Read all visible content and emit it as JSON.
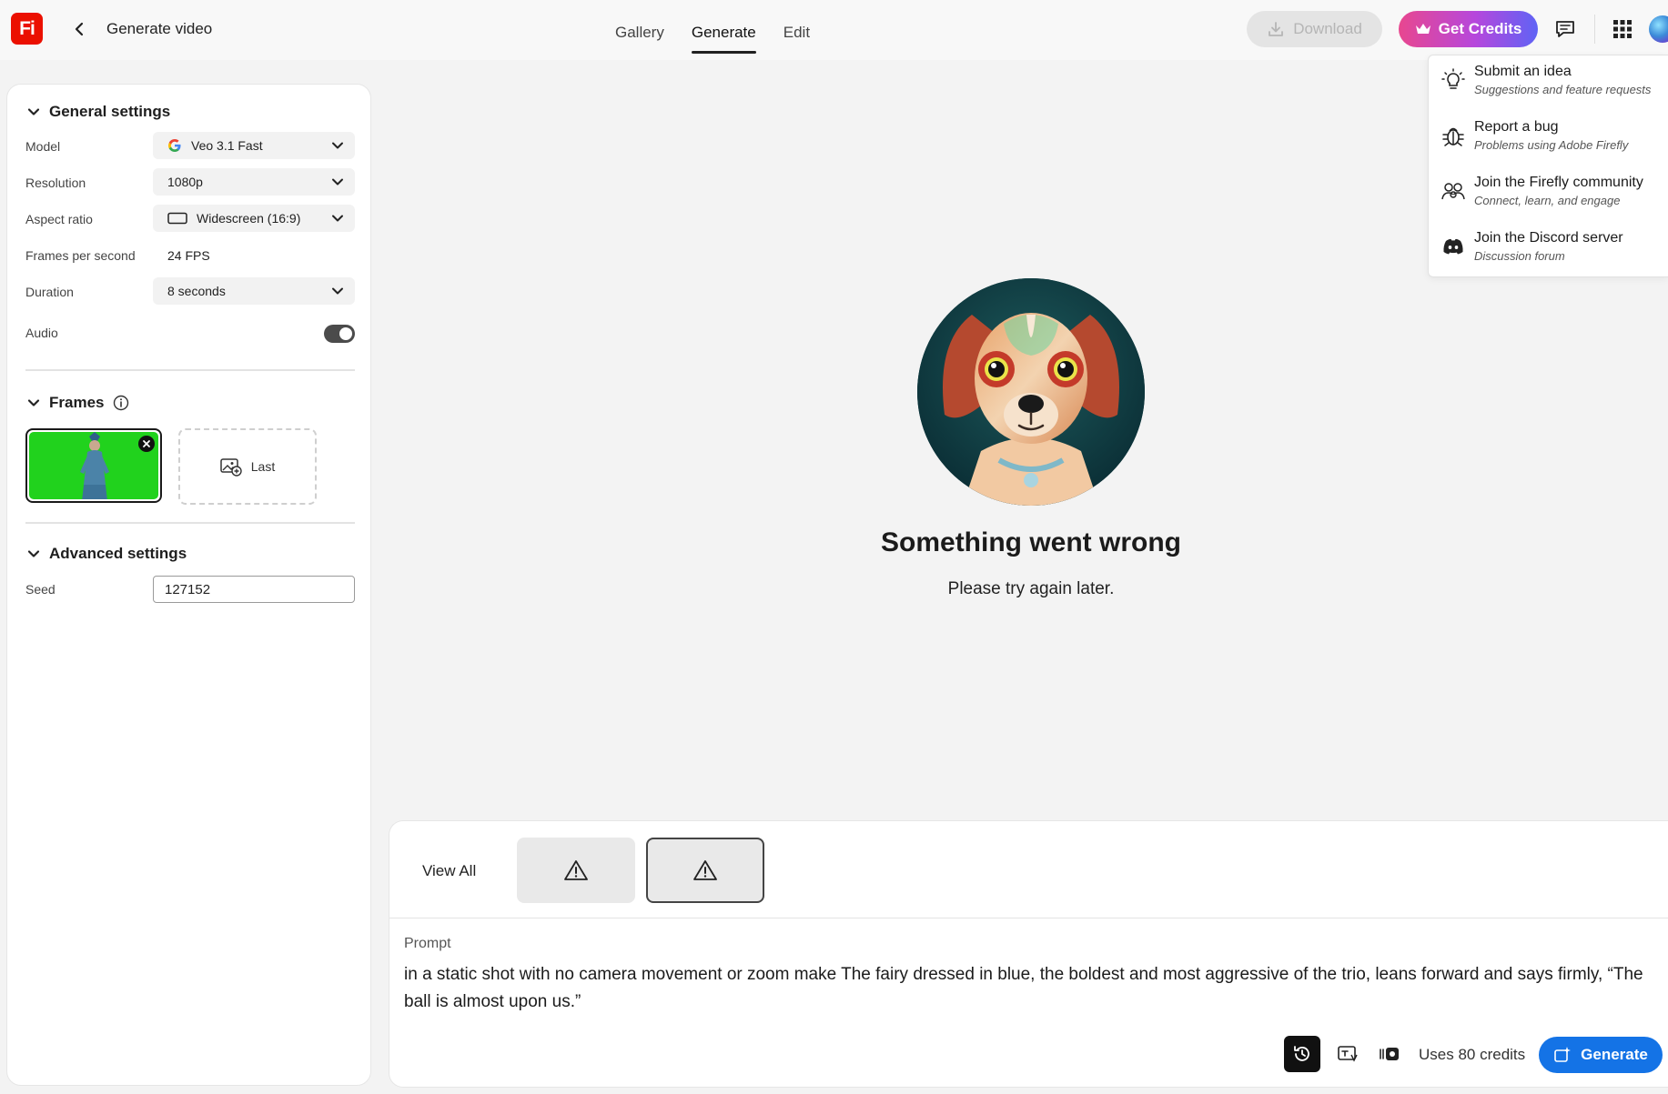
{
  "app": {
    "logo_text": "Fi",
    "page_title": "Generate video"
  },
  "nav": {
    "tabs": [
      "Gallery",
      "Generate",
      "Edit"
    ],
    "active": "Generate"
  },
  "toolbar": {
    "download_label": "Download",
    "get_credits_label": "Get Credits"
  },
  "general_settings": {
    "title": "General settings",
    "model_label": "Model",
    "model_value": "Veo 3.1 Fast",
    "resolution_label": "Resolution",
    "resolution_value": "1080p",
    "aspect_label": "Aspect ratio",
    "aspect_value": "Widescreen (16:9)",
    "fps_label": "Frames per second",
    "fps_value": "24 FPS",
    "duration_label": "Duration",
    "duration_value": "8 seconds",
    "audio_label": "Audio",
    "audio_on": true
  },
  "frames": {
    "title": "Frames",
    "last_label": "Last"
  },
  "advanced_settings": {
    "title": "Advanced settings",
    "seed_label": "Seed",
    "seed_value": "127152"
  },
  "error": {
    "title": "Something went wrong",
    "message": "Please try again later."
  },
  "history": {
    "view_all": "View All"
  },
  "prompt": {
    "label": "Prompt",
    "text": "in a static shot with no camera movement or zoom make The fairy dressed in blue, the boldest and most aggressive of the trio, leans forward and says firmly, “The ball is almost upon us.”"
  },
  "footer": {
    "uses_credits": "Uses 80 credits",
    "generate_label": "Generate"
  },
  "help_menu": {
    "items": [
      {
        "title": "Submit an idea",
        "subtitle": "Suggestions and feature requests",
        "icon": "lightbulb-icon"
      },
      {
        "title": "Report a bug",
        "subtitle": "Problems using Adobe Firefly",
        "icon": "bug-icon"
      },
      {
        "title": "Join the Firefly community",
        "subtitle": "Connect, learn, and engage",
        "icon": "community-icon"
      },
      {
        "title": "Join the Discord server",
        "subtitle": "Discussion forum",
        "icon": "discord-icon"
      }
    ]
  },
  "colors": {
    "brand_red": "#eb1000",
    "generate_blue": "#1473e6",
    "credits_gradient_start": "#e8478f",
    "credits_gradient_end": "#5f63f5",
    "frame_green": "#21d21d"
  }
}
